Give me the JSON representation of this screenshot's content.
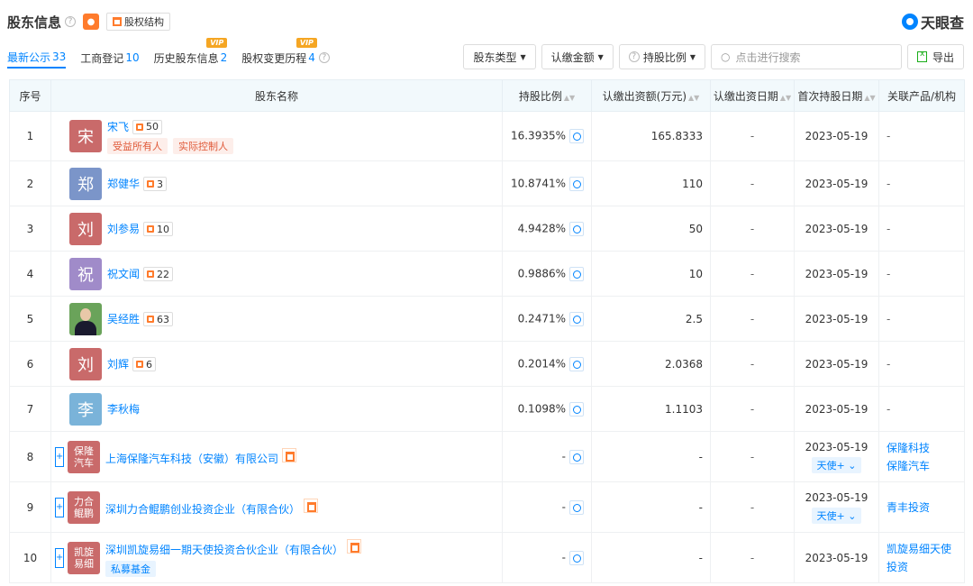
{
  "header": {
    "title": "股东信息",
    "struct_label": "股权结构",
    "logo": "天眼查"
  },
  "tabs": [
    {
      "label": "最新公示",
      "count": "33",
      "vip": ""
    },
    {
      "label": "工商登记",
      "count": "10",
      "vip": ""
    },
    {
      "label": "历史股东信息",
      "count": "2",
      "vip": "VIP"
    },
    {
      "label": "股权变更历程",
      "count": "4",
      "vip": "VIP"
    }
  ],
  "toolbar": {
    "type_label": "股东类型",
    "amount_label": "认缴金额",
    "ratio_label": "持股比例",
    "search_placeholder": "点击进行搜索",
    "export_label": "导出"
  },
  "columns": [
    "序号",
    "股东名称",
    "持股比例",
    "认缴出资额(万元)",
    "认缴出资日期",
    "首次持股日期",
    "关联产品/机构"
  ],
  "rows": [
    {
      "idx": "1",
      "avatar": "宋",
      "avatar_color": "#c96a6a",
      "name": "宋飞",
      "links": "50",
      "tags": [
        "受益所有人",
        "实际控制人"
      ],
      "pct": "16.3935%",
      "amount": "165.8333",
      "sub_date": "-",
      "first_date": "2023-05-19",
      "round": "",
      "rel": [
        "-"
      ]
    },
    {
      "idx": "2",
      "avatar": "郑",
      "avatar_color": "#7b95c9",
      "name": "郑健华",
      "links": "3",
      "tags": [],
      "pct": "10.8741%",
      "amount": "110",
      "sub_date": "-",
      "first_date": "2023-05-19",
      "round": "",
      "rel": [
        "-"
      ]
    },
    {
      "idx": "3",
      "avatar": "刘",
      "avatar_color": "#c96a6a",
      "name": "刘参易",
      "links": "10",
      "tags": [],
      "pct": "4.9428%",
      "amount": "50",
      "sub_date": "-",
      "first_date": "2023-05-19",
      "round": "",
      "rel": [
        "-"
      ]
    },
    {
      "idx": "4",
      "avatar": "祝",
      "avatar_color": "#a08bc9",
      "name": "祝文闻",
      "links": "22",
      "tags": [],
      "pct": "0.9886%",
      "amount": "10",
      "sub_date": "-",
      "first_date": "2023-05-19",
      "round": "",
      "rel": [
        "-"
      ]
    },
    {
      "idx": "5",
      "avatar": "",
      "avatar_color": "",
      "name": "吴经胜",
      "links": "63",
      "tags": [],
      "pct": "0.2471%",
      "amount": "2.5",
      "sub_date": "-",
      "first_date": "2023-05-19",
      "round": "",
      "rel": [
        "-"
      ]
    },
    {
      "idx": "6",
      "avatar": "刘",
      "avatar_color": "#c96a6a",
      "name": "刘辉",
      "links": "6",
      "tags": [],
      "pct": "0.2014%",
      "amount": "2.0368",
      "sub_date": "-",
      "first_date": "2023-05-19",
      "round": "",
      "rel": [
        "-"
      ]
    },
    {
      "idx": "7",
      "avatar": "李",
      "avatar_color": "#7ab3d9",
      "name": "李秋梅",
      "links": "",
      "tags": [],
      "pct": "0.1098%",
      "amount": "1.1103",
      "sub_date": "-",
      "first_date": "2023-05-19",
      "round": "",
      "rel": [
        "-"
      ]
    },
    {
      "idx": "8",
      "avatar": "保隆汽车",
      "avatar_color": "#c96a6a",
      "name": "上海保隆汽车科技（安徽）有限公司",
      "links": "",
      "tags": [],
      "pct": "-",
      "amount": "-",
      "sub_date": "-",
      "first_date": "2023-05-19",
      "round": "天使+",
      "rel": [
        "保隆科技",
        "保隆汽车"
      ]
    },
    {
      "idx": "9",
      "avatar": "力合鲲鹏",
      "avatar_color": "#c96a6a",
      "name": "深圳力合鲲鹏创业投资企业（有限合伙）",
      "links": "",
      "tags": [],
      "pct": "-",
      "amount": "-",
      "sub_date": "-",
      "first_date": "2023-05-19",
      "round": "天使+",
      "rel": [
        "青丰投资"
      ]
    },
    {
      "idx": "10",
      "avatar": "凯旋易细",
      "avatar_color": "#c96a6a",
      "name": "深圳凯旋易细一期天使投资合伙企业（有限合伙）",
      "links": "",
      "tags": [
        "私募基金"
      ],
      "pct": "-",
      "amount": "-",
      "sub_date": "-",
      "first_date": "2023-05-19",
      "round": "",
      "rel": [
        "凯旋易细天使",
        "投资"
      ]
    }
  ],
  "colors": {
    "accent": "#0084ff",
    "orange": "#ff7b2c",
    "header_bg": "#f2f9fc"
  }
}
